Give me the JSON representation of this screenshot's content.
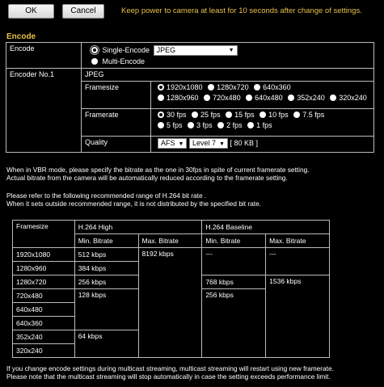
{
  "toolbar": {
    "ok_label": "OK",
    "cancel_label": "Cancel",
    "warning": "Keep power to camera at least for 10 seconds after change of settings."
  },
  "encode_section": {
    "title": "Encode",
    "encode": {
      "label": "Encode",
      "single_label": "Single-Encode",
      "single_format": "JPEG",
      "multi_label": "Multi-Encode"
    },
    "encoder1": {
      "label": "Encoder No.1",
      "format": "JPEG",
      "framesize_label": "Framesize",
      "framesizes": [
        "1920x1080",
        "1280x720",
        "640x360",
        "1280x960",
        "720x480",
        "640x480",
        "352x240",
        "320x240"
      ],
      "framesize_selected": "1920x1080",
      "framerate_label": "Framerate",
      "framerates": [
        "30 fps",
        "25 fps",
        "15 fps",
        "10 fps",
        "7.5 fps",
        "5 fps",
        "3 fps",
        "2 fps",
        "1 fps"
      ],
      "framerate_selected": "30 fps",
      "quality_label": "Quality",
      "quality_mode": "AFS",
      "quality_level": "Level 7",
      "quality_size": "[ 80 KB ]"
    }
  },
  "notes": {
    "vbr_line1": "When in VBR mode, please specify the bitrate as the one in 30fps in spite of current framerate setting.",
    "vbr_line2": "Actual bitrate from the camera will be automatically reduced according to the framerate setting.",
    "range_line1": "Please refer to the following recommended range of H.264 bit rate .",
    "range_line2": "When it sets outside recommended range, it is not distributed by the specified bit rate.",
    "multicast_line1": "If you change encode settings during multicast streaming, multicast streaming will restart using new framerate.",
    "multicast_line2": "Please note that the multicast streaming will stop automatically in case the setting exceeds performance limit."
  },
  "bitrate_table": {
    "framesize_header": "Framesize",
    "high_header": "H.264 High",
    "baseline_header": "H.264 Baseline",
    "min_header": "Min. Bitrate",
    "max_header": "Max. Bitrate",
    "framesizes": [
      "1920x1080",
      "1280x960",
      "1280x720",
      "720x480",
      "640x480",
      "640x360",
      "352x240",
      "320x240"
    ],
    "high_min": [
      "512 kbps",
      "384 kbps",
      "256 kbps",
      "128 kbps",
      "64 kbps"
    ],
    "high_max": "8192 kbps",
    "baseline_min": [
      "---",
      "768 kbps",
      "256 kbps"
    ],
    "baseline_max": [
      "---",
      "1536 kbps"
    ]
  }
}
